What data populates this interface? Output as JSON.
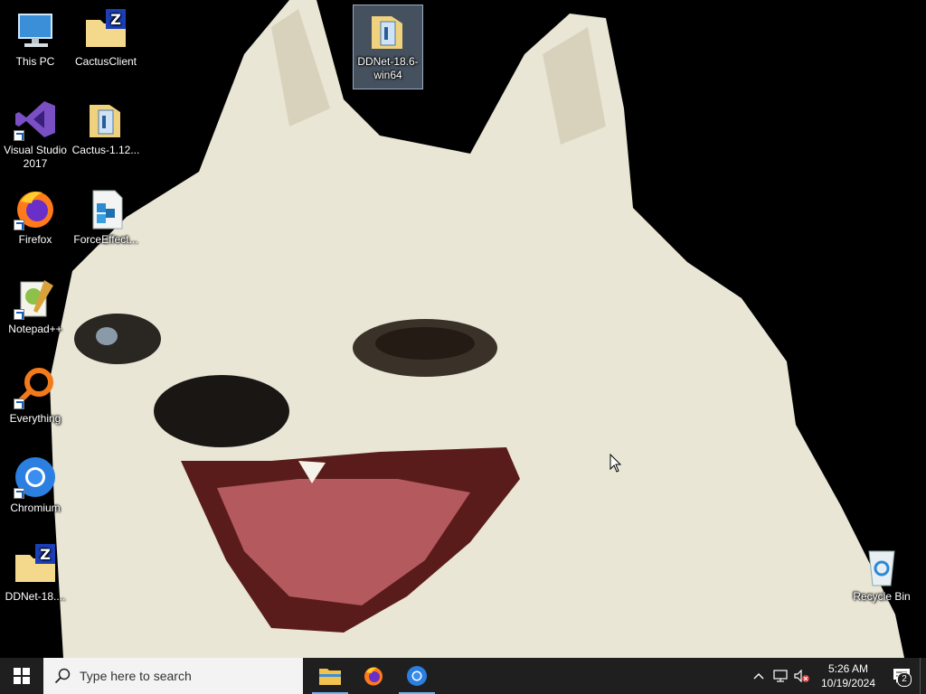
{
  "desktop": {
    "icons": [
      {
        "label": "This PC",
        "icon": "this-pc-icon"
      },
      {
        "label": "CactusClient",
        "icon": "zip-folder-icon"
      },
      {
        "label": "DDNet-18.6-win64",
        "icon": "folder-icon"
      },
      {
        "label": "Visual Studio 2017",
        "icon": "visual-studio-icon"
      },
      {
        "label": "Cactus-1.12...",
        "icon": "folder-icon"
      },
      {
        "label": "Firefox",
        "icon": "firefox-icon"
      },
      {
        "label": "ForceEffect...",
        "icon": "installer-icon"
      },
      {
        "label": "Notepad++",
        "icon": "notepadpp-icon"
      },
      {
        "label": "Everything",
        "icon": "everything-icon"
      },
      {
        "label": "Chromium",
        "icon": "chromium-icon"
      },
      {
        "label": "DDNet-18....",
        "icon": "zip-folder-icon"
      },
      {
        "label": "Recycle Bin",
        "icon": "recycle-bin-icon"
      }
    ]
  },
  "taskbar": {
    "search_placeholder": "Type here to search",
    "pinned": [
      {
        "name": "File Explorer",
        "icon": "file-explorer-icon",
        "active": true
      },
      {
        "name": "Firefox",
        "icon": "firefox-icon",
        "active": false
      },
      {
        "name": "Chromium",
        "icon": "chromium-icon",
        "active": true
      }
    ],
    "clock": {
      "time": "5:26 AM",
      "date": "10/19/2024"
    },
    "notification_count": "2"
  },
  "colors": {
    "taskbar_bg": "#1f1f1f",
    "active_indicator": "#6fb3f2",
    "wallpaper_bg": "#000000"
  }
}
